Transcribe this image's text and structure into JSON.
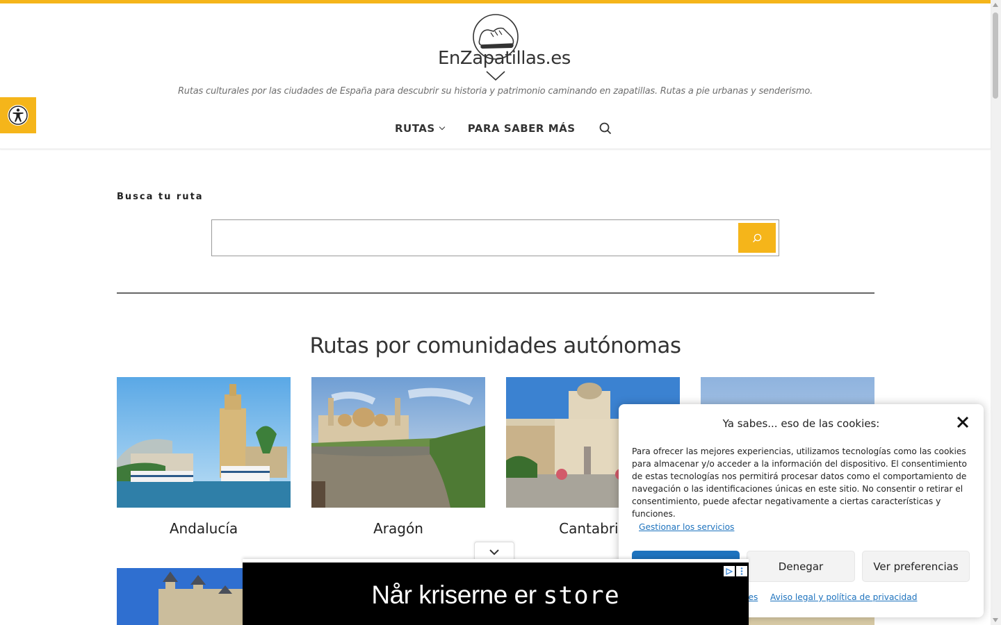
{
  "site": {
    "logo_text": "EnZapatillas.es",
    "tagline": "Rutas culturales por las ciudades de España para descubrir su historia y patrimonio caminando en zapatillas. Rutas a pie urbanas y senderismo.",
    "accent_color": "#f5b51a"
  },
  "nav": {
    "items": [
      {
        "label": "RUTAS",
        "has_dropdown": true
      },
      {
        "label": "PARA SABER MÁS",
        "has_dropdown": false
      }
    ],
    "search_icon": "search-icon"
  },
  "search": {
    "heading": "Busca tu ruta",
    "placeholder": "",
    "button_icon": "search-icon"
  },
  "section": {
    "title": "Rutas por comunidades autónomas",
    "cards": [
      {
        "label": "Andalucía"
      },
      {
        "label": "Aragón"
      },
      {
        "label": "Cantabria"
      },
      {
        "label": ""
      }
    ]
  },
  "cookie": {
    "title": "Ya sabes... eso de las cookies:",
    "text": "Para ofrecer las mejores experiencias, utilizamos tecnologías como las cookies para almacenar y/o acceder a la información del dispositivo. El consentimiento de estas tecnologías nos permitirá procesar datos como el comportamiento de navegación o las identificaciones únicas en este sitio. No consentir o retirar el consentimiento, puede afectar negativamente a ciertas características y funciones.",
    "manage_link": "Gestionar los servicios",
    "accept_label": "",
    "deny_label": "Denegar",
    "prefs_label": "Ver preferencias",
    "links": [
      "kies",
      "Aviso legal y política de privacidad"
    ],
    "primary_color": "#1e73be"
  },
  "ad": {
    "text_prefix": "Når kriserne er ",
    "text_mono": "store"
  }
}
